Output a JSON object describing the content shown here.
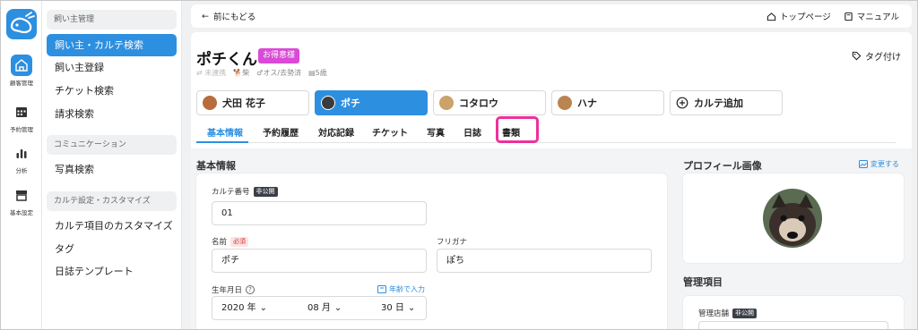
{
  "rail": {
    "items": [
      {
        "label": "顧客管理",
        "icon": "dog-house-icon",
        "active": true
      },
      {
        "label": "予約管理",
        "icon": "calendar-icon",
        "active": false
      },
      {
        "label": "分析",
        "icon": "bar-chart-icon",
        "active": false
      },
      {
        "label": "基本設定",
        "icon": "store-icon",
        "active": false
      }
    ]
  },
  "sidebar": {
    "section1": "飼い主管理",
    "items1": [
      "飼い主・カルテ検索",
      "飼い主登録",
      "チケット検索",
      "請求検索"
    ],
    "section2": "コミュニケーション",
    "items2": [
      "写真検索"
    ],
    "section3": "カルテ設定・カスタマイズ",
    "items3": [
      "カルテ項目のカスタマイズ",
      "タグ",
      "日誌テンプレート"
    ]
  },
  "topbar": {
    "back": "前にもどる",
    "top_page": "トップページ",
    "manual": "マニュアル"
  },
  "pet": {
    "name": "ポチくん",
    "badge": "お得意様",
    "tag_button": "タグ付け",
    "unlinked": "未連携",
    "breed": "柴",
    "sex": "オス/去勢済",
    "age": "5歳"
  },
  "cards": [
    {
      "label": "犬田 花子",
      "active": false
    },
    {
      "label": "ポチ",
      "active": true
    },
    {
      "label": "コタロウ",
      "active": false
    },
    {
      "label": "ハナ",
      "active": false
    },
    {
      "label": "カルテ追加",
      "active": false
    }
  ],
  "tabs": [
    "基本情報",
    "予約履歴",
    "対応記録",
    "チケット",
    "写真",
    "日誌",
    "書類"
  ],
  "basic": {
    "section_title": "基本情報",
    "karte_label": "カルテ番号",
    "private_tag": "非公開",
    "karte_value": "01",
    "name_label": "名前",
    "required_tag": "必須",
    "name_value": "ポチ",
    "kana_label": "フリガナ",
    "kana_value": "ぽち",
    "birth_label": "生年月日",
    "age_link": "年齢で入力",
    "year": "2020 年",
    "month": "08 月",
    "day": "30 日"
  },
  "profile": {
    "title": "プロフィール画像",
    "change": "変更する"
  },
  "management": {
    "title": "管理項目",
    "store_label": "管理店舗",
    "private_tag": "非公開"
  },
  "colors": {
    "accent": "#2d8fe0",
    "highlight": "#ef2f9c",
    "vip": "#d94ad6"
  }
}
